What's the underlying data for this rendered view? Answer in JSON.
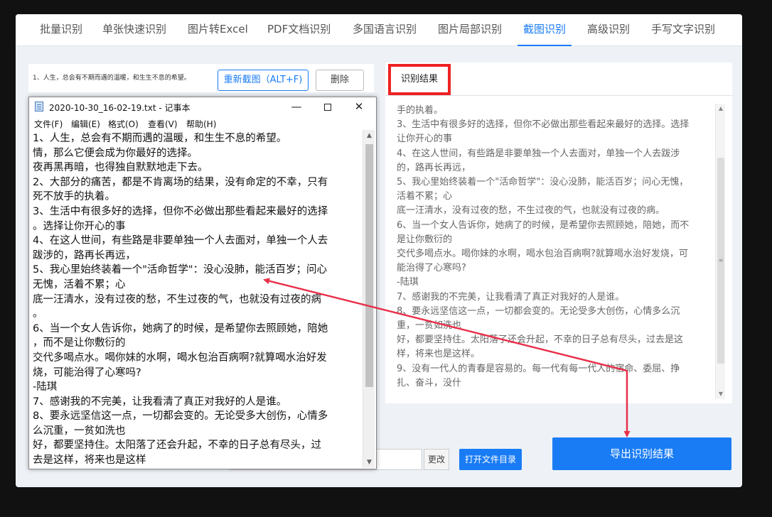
{
  "tabs": [
    {
      "label": "批量识别"
    },
    {
      "label": "单张快速识别"
    },
    {
      "label": "图片转Excel"
    },
    {
      "label": "PDF文档识别"
    },
    {
      "label": "多国语言识别"
    },
    {
      "label": "图片局部识别"
    },
    {
      "label": "截图识别",
      "active": true
    },
    {
      "label": "高级识别"
    },
    {
      "label": "手写文字识别"
    }
  ],
  "capture": {
    "snippet": "1、人生，总会有不期而遇的温暖，和生生不息的希望。",
    "recapture_label": "重新截图（ALT+F)",
    "delete_label": "删除"
  },
  "result": {
    "tab_label": "识别结果",
    "lines": [
      "手的执着。",
      "3、生活中有很多好的选择，但你不必做出那些看起来最好的选择。选择",
      "让你开心的事",
      "4、在这人世间，有些路是非要单独一个人去面对，单独一个人去跋涉",
      "的，路再长再远，",
      "5、我心里始终装着一个\"活命哲学\"：没心没肺，能活百岁；问心无愧，",
      "活着不累；心",
      "底一汪清水，没有过夜的愁，不生过夜的气，也就没有过夜的病。",
      "6、当一个女人告诉你，她病了的时候，是希望你去照顾她，陪她，而不",
      "是让你敷衍的",
      "交代多喝点水。喝你妹的水啊，喝水包治百病啊?就算喝水治好发烧，可",
      "能治得了心寒吗?",
      "-陆琪",
      "7、感谢我的不完美，让我看清了真正对我好的人是谁。",
      "8、要永远坚信这一点，一切都会变的。无论受多大创伤，心情多么沉",
      "重，一贫如洗也",
      "好，都要坚持住。太阳落了还会升起，不幸的日子总有尽头，过去是这",
      "样，将来也是这样。",
      "9、没有一代人的青春是容易的。每一代有每一代人的宿命、委屈、挣",
      "扎、奋斗，没什"
    ]
  },
  "controls": {
    "change_label": "更改",
    "open_dir_label": "打开文件目录",
    "export_label": "导出识别结果"
  },
  "notepad": {
    "title": "2020-10-30_16-02-19.txt - 记事本",
    "minimize": "—",
    "close": "✕",
    "menus": [
      {
        "label": "文件(F)"
      },
      {
        "label": "编辑(E)"
      },
      {
        "label": "格式(O)"
      },
      {
        "label": "查看(V)"
      },
      {
        "label": "帮助(H)"
      }
    ],
    "lines": [
      "1、人生，总会有不期而遇的温暖，和生生不息的希望。",
      "情，那么它便会成为你最好的选择。",
      "夜再黑再暗，也得独自默默地走下去。",
      "2、大部分的痛苦，都是不肯离场的结果，没有命定的不幸，只有",
      "死不放手的执着。",
      "3、生活中有很多好的选择，但你不必做出那些看起来最好的选择",
      "。选择让你开心的事",
      "4、在这人世间，有些路是非要单独一个人去面对，单独一个人去",
      "跋涉的，路再长再远，",
      "5、我心里始终装着一个\"活命哲学\"：没心没肺，能活百岁；问心",
      "无愧，活着不累；心",
      "底一汪清水，没有过夜的愁，不生过夜的气，也就没有过夜的病",
      "。",
      "6、当一个女人告诉你，她病了的时候，是希望你去照顾她，陪她",
      "，而不是让你敷衍的",
      "交代多喝点水。喝你妹的水啊，喝水包治百病啊?就算喝水治好发",
      "烧，可能治得了心寒吗?",
      "-陆琪",
      "7、感谢我的不完美，让我看清了真正对我好的人是谁。",
      "8、要永远坚信这一点，一切都会变的。无论受多大创伤，心情多",
      "么沉重，一贫如洗也",
      "好，都要坚持住。太阳落了还会升起，不幸的日子总有尽头，过",
      "去是这样，将来也是这样"
    ]
  },
  "colors": {
    "accent": "#1a7cf5",
    "highlight_box": "#ee2222",
    "arrow": "#e8304a"
  }
}
